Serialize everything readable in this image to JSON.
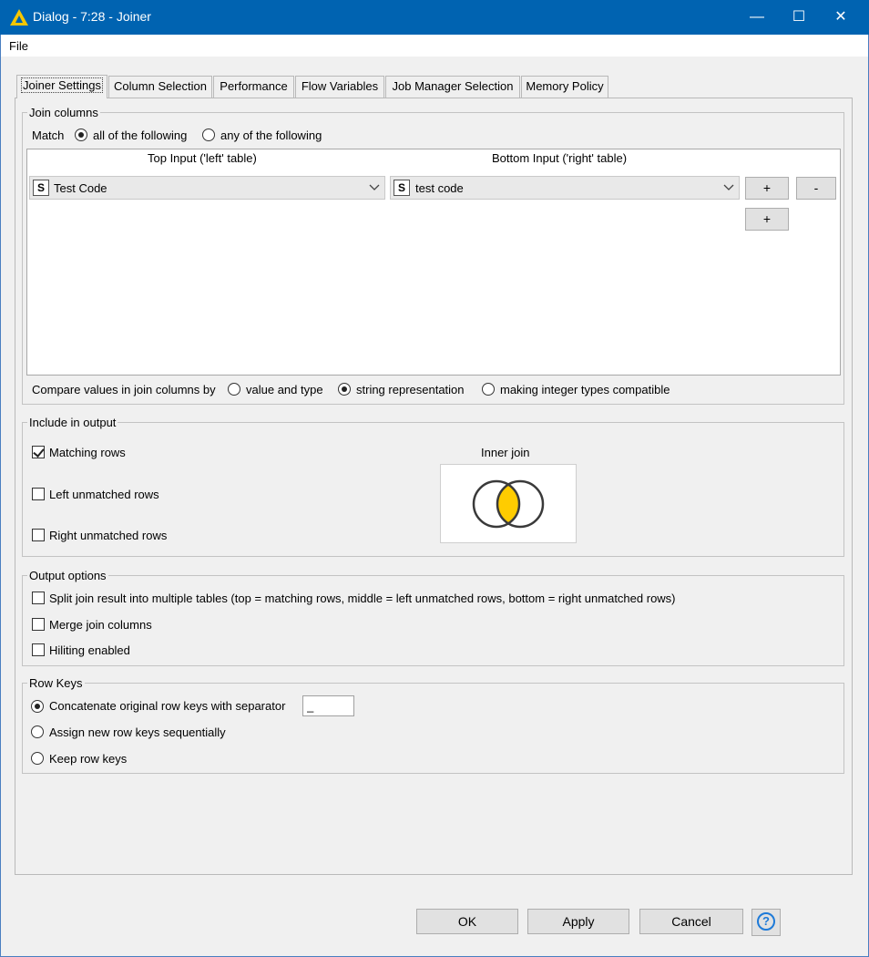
{
  "window": {
    "title": "Dialog - 7:28 - Joiner",
    "minimize_glyph": "—",
    "maximize_glyph": "☐",
    "close_glyph": "✕",
    "accent_color": "#0063b1"
  },
  "menu": {
    "file": "File"
  },
  "tabs": [
    {
      "label": "Joiner Settings",
      "active": true
    },
    {
      "label": "Column Selection"
    },
    {
      "label": "Performance"
    },
    {
      "label": "Flow Variables"
    },
    {
      "label": "Job Manager Selection"
    },
    {
      "label": "Memory Policy"
    }
  ],
  "join_columns": {
    "legend": "Join columns",
    "match_label": "Match",
    "match_all": "all of the following",
    "match_any": "any of the following",
    "match_selected": "all",
    "top_header": "Top Input ('left' table)",
    "bottom_header": "Bottom Input ('right' table)",
    "left_type_badge": "S",
    "left_column": "Test Code",
    "right_type_badge": "S",
    "right_column": "test code",
    "add_label": "+",
    "remove_label": "-",
    "compare_label": "Compare values in join columns by",
    "compare_value_type": "value and type",
    "compare_string": "string representation",
    "compare_integer": "making integer types compatible",
    "compare_selected": "string representation"
  },
  "include_output": {
    "legend": "Include in output",
    "matching_rows": "Matching rows",
    "matching_checked": true,
    "left_unmatched": "Left unmatched rows",
    "left_checked": false,
    "right_unmatched": "Right unmatched rows",
    "right_checked": false,
    "join_type_label": "Inner join",
    "venn_fill_color": "#ffcc00"
  },
  "output_options": {
    "legend": "Output options",
    "split": "Split join result into multiple tables (top = matching rows, middle = left unmatched rows, bottom = right unmatched rows)",
    "merge": "Merge join columns",
    "hiliting": "Hiliting enabled"
  },
  "row_keys": {
    "legend": "Row Keys",
    "concatenate": "Concatenate original row keys with separator",
    "separator_value": "_",
    "assign_new": "Assign new row keys sequentially",
    "keep": "Keep row keys",
    "selected": "concatenate"
  },
  "buttons": {
    "ok": "OK",
    "apply": "Apply",
    "cancel": "Cancel",
    "help": "?"
  }
}
